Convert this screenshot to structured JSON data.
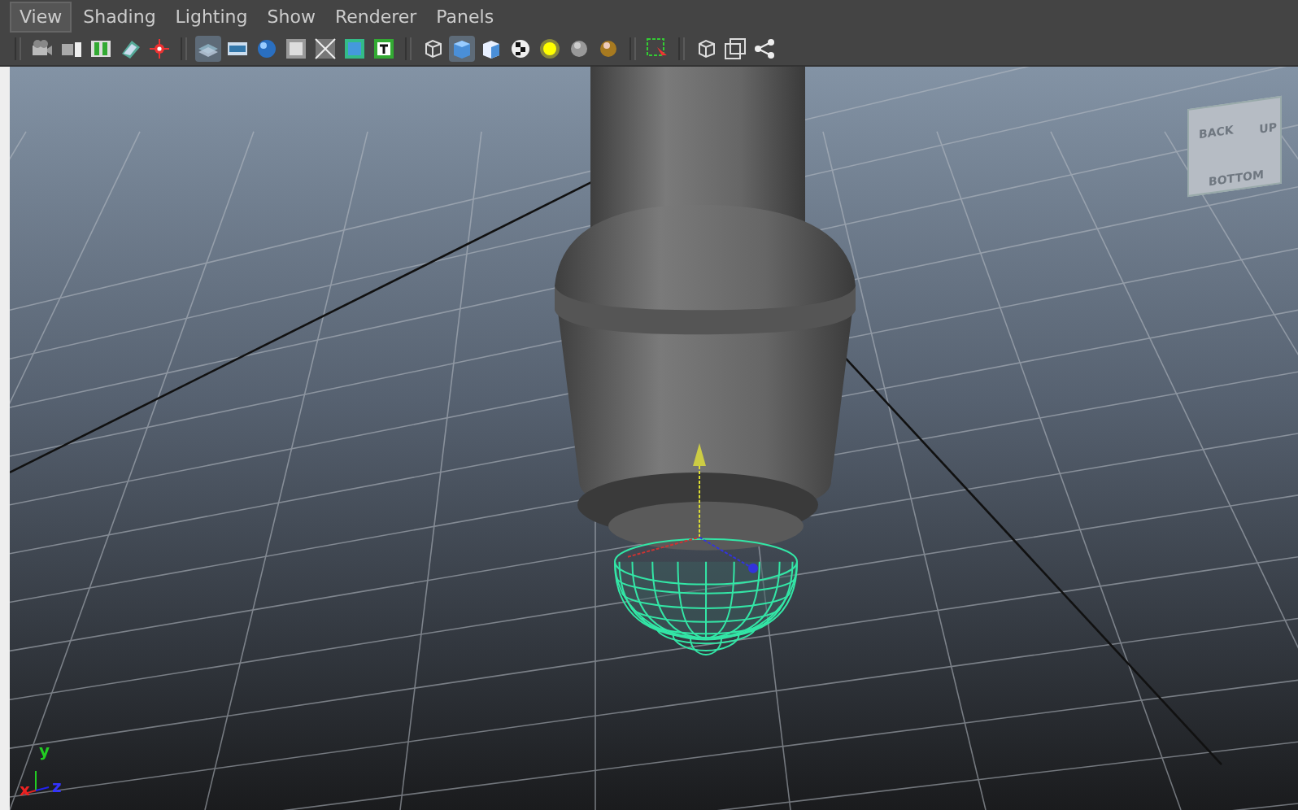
{
  "menu": [
    {
      "label": "View",
      "selected": true
    },
    {
      "label": "Shading",
      "selected": false
    },
    {
      "label": "Lighting",
      "selected": false
    },
    {
      "label": "Show",
      "selected": false
    },
    {
      "label": "Renderer",
      "selected": false
    },
    {
      "label": "Panels",
      "selected": false
    }
  ],
  "toolbar": [
    [
      {
        "kind": "camera",
        "selected": false
      },
      {
        "kind": "camera-attr",
        "selected": false
      },
      {
        "kind": "bookmark",
        "selected": false
      },
      {
        "kind": "image-plane",
        "selected": false
      },
      {
        "kind": "snap",
        "selected": false
      }
    ],
    [
      {
        "kind": "layers",
        "selected": true
      },
      {
        "kind": "film",
        "selected": false
      },
      {
        "kind": "ball",
        "selected": false
      },
      {
        "kind": "gate",
        "selected": false
      },
      {
        "kind": "grid",
        "selected": false
      },
      {
        "kind": "safe",
        "selected": false
      },
      {
        "kind": "text-tool",
        "selected": false
      }
    ],
    [
      {
        "kind": "cube-wire",
        "selected": false
      },
      {
        "kind": "cube-solid",
        "selected": true
      },
      {
        "kind": "cube-textured",
        "selected": false
      },
      {
        "kind": "checker",
        "selected": false
      },
      {
        "kind": "light-yellow",
        "selected": false
      },
      {
        "kind": "sphere-grey",
        "selected": false
      },
      {
        "kind": "sphere-gold",
        "selected": false
      }
    ],
    [
      {
        "kind": "marquee",
        "selected": false
      }
    ],
    [
      {
        "kind": "cube-wire",
        "selected": false
      },
      {
        "kind": "frame",
        "selected": false
      },
      {
        "kind": "nodes",
        "selected": false
      }
    ]
  ],
  "view_cube": {
    "faces": [
      "BACK",
      "UP",
      "BOTTOM"
    ]
  },
  "axis_indicator": {
    "labels": [
      "x",
      "y",
      "z"
    ]
  }
}
